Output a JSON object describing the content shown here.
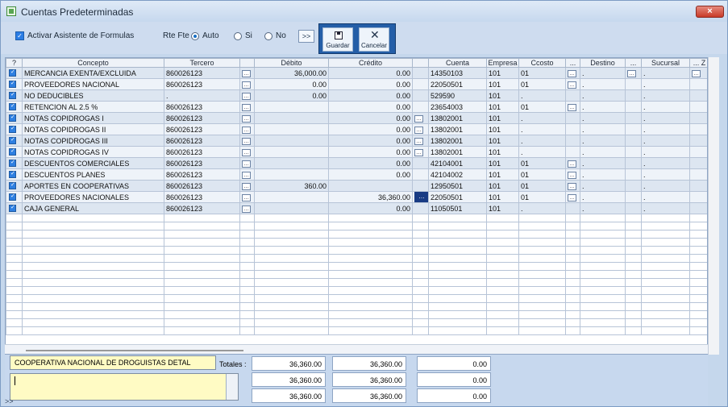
{
  "window": {
    "title": "Cuentas Predeterminadas",
    "close_glyph": "×"
  },
  "toolbar": {
    "asistente_label": "Activar Asistente de Formulas",
    "rtefte_label": "Rte Fte",
    "radio_auto": "Auto",
    "radio_si": "Si",
    "radio_no": "No",
    "more": ">>",
    "save_label": "Guardar",
    "cancel_label": "Cancelar"
  },
  "grid": {
    "headers": [
      "?",
      "Concepto",
      "Tercero",
      "",
      "Débito",
      "Crédito",
      "",
      "Cuenta",
      "Empresa",
      "Ccosto",
      "...",
      "Destino",
      "...",
      "Sucursal",
      "... Z"
    ],
    "rows": [
      {
        "concepto": "MERCANCIA EXENTA/EXCLUIDA",
        "tercero": "860026123",
        "debito": "36,000.00",
        "credito": "0.00",
        "cuenta": "14350103",
        "empresa": "101",
        "ccosto": "01",
        "destino": ".",
        "sucursal": "."
      },
      {
        "concepto": "PROVEEDORES NACIONAL",
        "tercero": "860026123",
        "debito": "0.00",
        "credito": "0.00",
        "cuenta": "22050501",
        "empresa": "101",
        "ccosto": "01",
        "destino": ".",
        "sucursal": "."
      },
      {
        "concepto": "NO DEDUCIBLES",
        "tercero": ".",
        "debito": "0.00",
        "credito": "0.00",
        "cuenta": "529590",
        "empresa": "101",
        "ccosto": ".",
        "destino": ".",
        "sucursal": "."
      },
      {
        "concepto": "RETENCION AL  2.5 %",
        "tercero": "860026123",
        "debito": "",
        "credito": "0.00",
        "cuenta": "23654003",
        "empresa": "101",
        "ccosto": "01",
        "destino": ".",
        "sucursal": "."
      },
      {
        "concepto": "NOTAS COPIDROGAS I",
        "tercero": "860026123",
        "debito": "",
        "credito": "0.00",
        "cuenta": "13802001",
        "empresa": "101",
        "ccosto": ".",
        "destino": ".",
        "sucursal": "."
      },
      {
        "concepto": "NOTAS COPIDROGAS II",
        "tercero": "860026123",
        "debito": "",
        "credito": "0.00",
        "cuenta": "13802001",
        "empresa": "101",
        "ccosto": ".",
        "destino": ".",
        "sucursal": "."
      },
      {
        "concepto": "NOTAS COPIDROGAS III",
        "tercero": "860026123",
        "debito": "",
        "credito": "0.00",
        "cuenta": "13802001",
        "empresa": "101",
        "ccosto": ".",
        "destino": ".",
        "sucursal": "."
      },
      {
        "concepto": "NOTAS COPIDROGAS IV",
        "tercero": "860026123",
        "debito": "",
        "credito": "0.00",
        "cuenta": "13802001",
        "empresa": "101",
        "ccosto": ".",
        "destino": ".",
        "sucursal": "."
      },
      {
        "concepto": "DESCUENTOS COMERCIALES",
        "tercero": "860026123",
        "debito": "",
        "credito": "0.00",
        "cuenta": "42104001",
        "empresa": "101",
        "ccosto": "01",
        "destino": ".",
        "sucursal": "."
      },
      {
        "concepto": "DESCUENTOS PLANES",
        "tercero": "860026123",
        "debito": "",
        "credito": "0.00",
        "cuenta": "42104002",
        "empresa": "101",
        "ccosto": "01",
        "destino": ".",
        "sucursal": "."
      },
      {
        "concepto": "APORTES EN COOPERATIVAS",
        "tercero": "860026123",
        "debito": "360.00",
        "credito": "",
        "cuenta": "12950501",
        "empresa": "101",
        "ccosto": "01",
        "destino": ".",
        "sucursal": "."
      },
      {
        "concepto": "PROVEEDORES NACIONALES",
        "tercero": "860026123",
        "debito": "",
        "credito": "36,360.00",
        "cuenta": "22050501",
        "empresa": "101",
        "ccosto": "01",
        "destino": ".",
        "sucursal": "."
      },
      {
        "concepto": "CAJA GENERAL",
        "tercero": "860026123",
        "debito": "",
        "credito": "0.00",
        "cuenta": "11050501",
        "empresa": "101",
        "ccosto": ".",
        "destino": ".",
        "sucursal": "."
      }
    ]
  },
  "footer": {
    "company": "COOPERATIVA NACIONAL DE DROGUISTAS DETAL",
    "totals_label": "Totales :",
    "totals": [
      [
        "36,360.00",
        "36,360.00",
        "0.00"
      ],
      [
        "36,360.00",
        "36,360.00",
        "0.00"
      ],
      [
        "36,360.00",
        "36,360.00",
        "0.00"
      ]
    ],
    "corner_mark": ">>"
  }
}
